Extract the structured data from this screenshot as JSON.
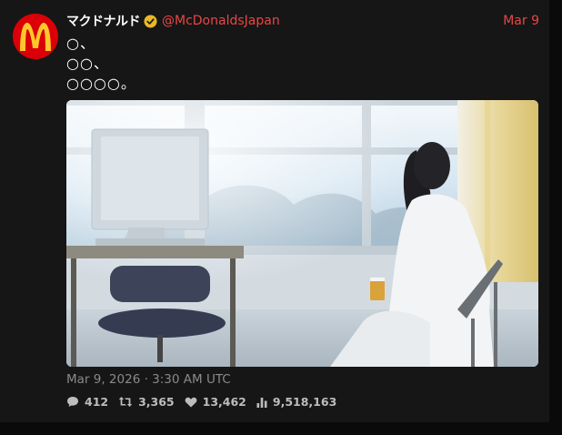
{
  "tweet": {
    "display_name": "マクドナルド",
    "handle": "@McDonaldsJapan",
    "date": "Mar 9",
    "text_lines": [
      "○、",
      "○○、",
      "○○○○。"
    ],
    "timestamp": "Mar 9, 2026 · 3:30 AM UTC",
    "stats": {
      "replies": "412",
      "retweets": "3,365",
      "likes": "13,462",
      "views": "9,518,163"
    }
  },
  "icons": {
    "avatar": "mcdonalds-logo",
    "verified": "verified-badge-icon",
    "replies": "comment-icon",
    "retweets": "retweet-icon",
    "likes": "heart-icon",
    "views": "bar-chart-icon"
  },
  "colors": {
    "card_bg": "#161616",
    "accent": "#e84646",
    "brand_red": "#db0007",
    "brand_yellow": "#ffc72c",
    "verified_gold": "#e8b829"
  }
}
